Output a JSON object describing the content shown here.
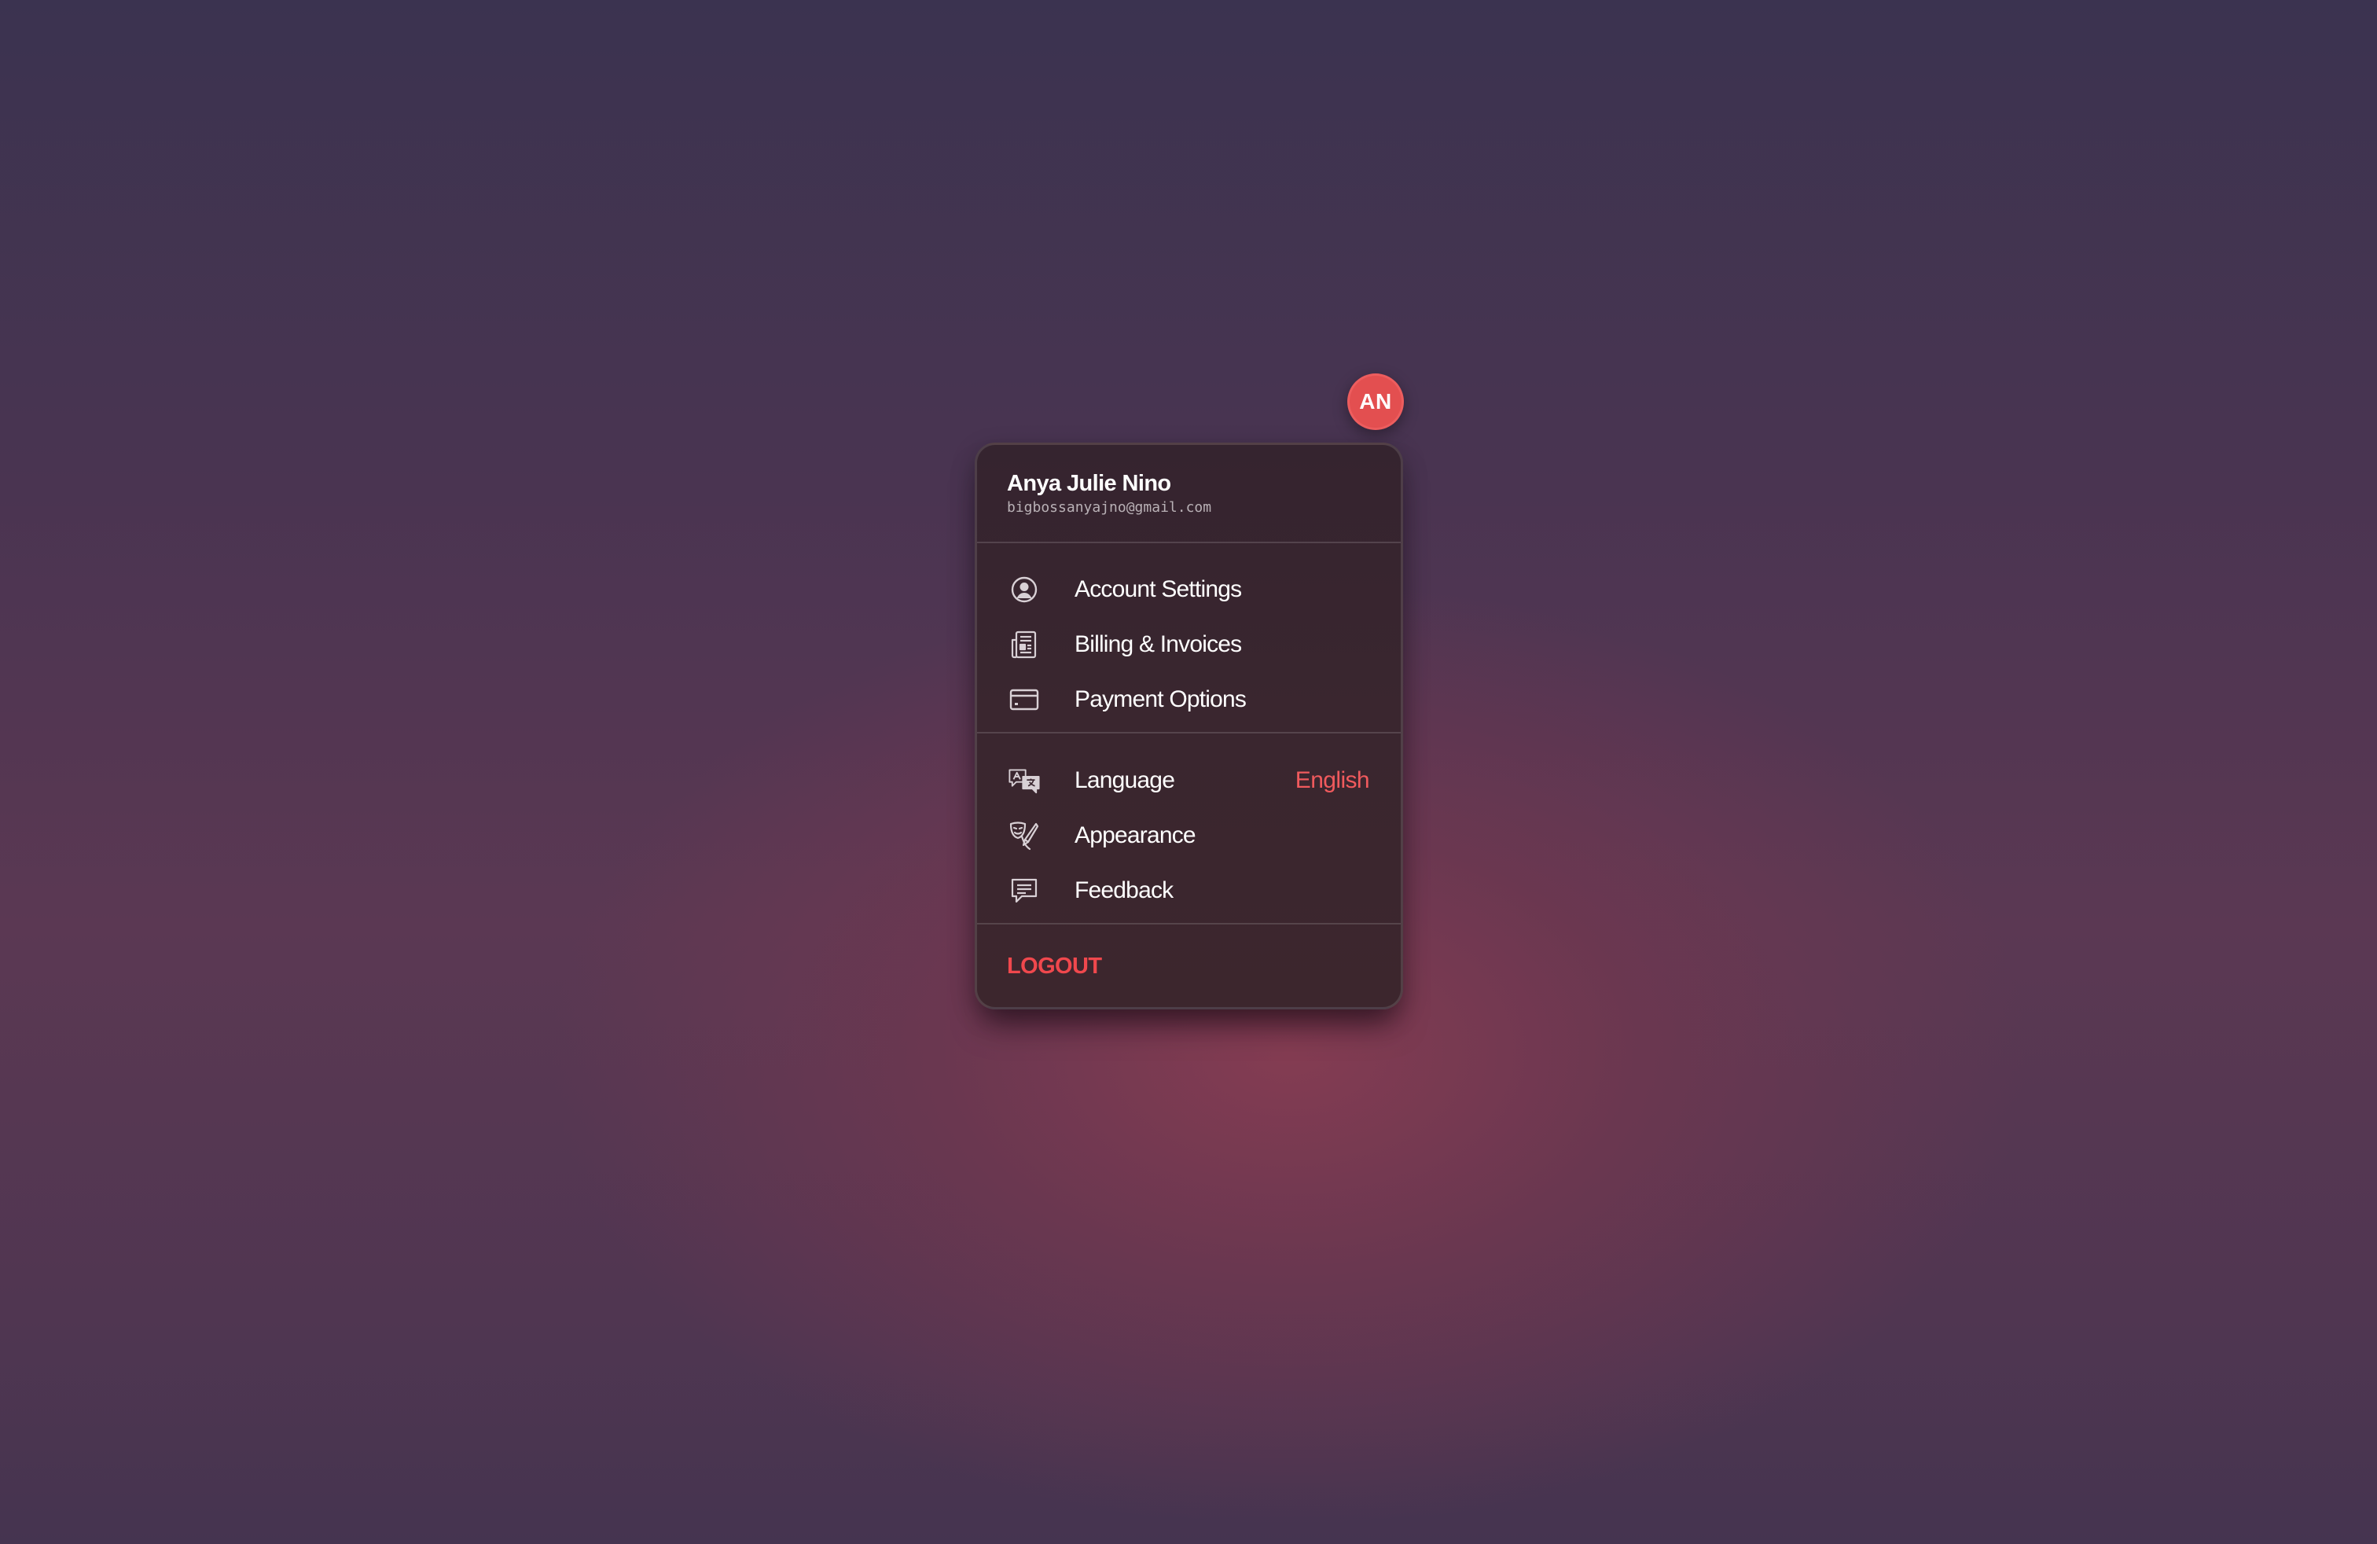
{
  "avatar": {
    "initials": "AN",
    "color": "#e34f50"
  },
  "user": {
    "name": "Anya Julie Nino",
    "email": "bigbossanyajno@gmail.com"
  },
  "sections": [
    {
      "items": [
        {
          "label": "Account Settings",
          "icon": "user-circle-icon"
        },
        {
          "label": "Billing & Invoices",
          "icon": "invoice-icon"
        },
        {
          "label": "Payment Options",
          "icon": "credit-card-icon"
        }
      ]
    },
    {
      "items": [
        {
          "label": "Language",
          "value": "English",
          "icon": "translate-icon"
        },
        {
          "label": "Appearance",
          "icon": "theater-masks-brush-icon"
        },
        {
          "label": "Feedback",
          "icon": "chat-bubble-icon"
        }
      ]
    }
  ],
  "logout": {
    "label": "LOGOUT",
    "color": "#f0484d"
  },
  "colors": {
    "accent": "#f05a5d",
    "menu_background": "#3a262f",
    "text": "#ffffff"
  }
}
